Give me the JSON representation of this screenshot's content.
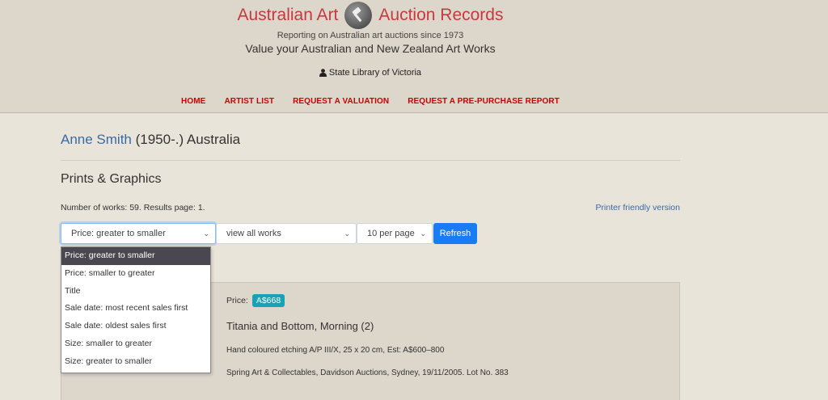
{
  "header": {
    "brand_left": "Australian Art",
    "brand_right": "Auction Records",
    "tagline": "Reporting on Australian art auctions since 1973",
    "tagline2": "Value your Australian and New Zealand Art Works",
    "library": "State Library of Victoria",
    "nav": [
      "HOME",
      "ARTIST LIST",
      "REQUEST A VALUATION",
      "REQUEST A PRE-PURCHASE REPORT"
    ]
  },
  "artist": {
    "name": "Anne Smith",
    "details": " (1950-.) Australia"
  },
  "section_title": "Prints & Graphics",
  "works_info": "Number of works: 59. Results page: 1.",
  "printer_link": "Printer friendly version",
  "controls": {
    "sort_value": "Price: greater to smaller",
    "view_value": "view all works",
    "per_page_value": "10 per page",
    "refresh_label": "Refresh"
  },
  "sort_options": [
    "Price: greater to smaller",
    "Price: smaller to greater",
    "Title",
    "Sale date: most recent sales first",
    "Sale date: oldest sales first",
    "Size: smaller to greater",
    "Size: greater to smaller"
  ],
  "result": {
    "price_label": "Price:",
    "price": "A$668",
    "title": "Titania and Bottom, Morning (2)",
    "description": "Hand coloured etching A/P III/X, 25 x 20 cm, Est: A$600–800",
    "sale": "Spring Art & Collectables, Davidson Auctions, Sydney, 19/11/2005. Lot No. 383"
  },
  "colors": {
    "brand": "#c8393f",
    "nav": "#cc0000",
    "link": "#3a6aa5",
    "button": "#1a7cf5",
    "badge": "#17a2b8"
  }
}
